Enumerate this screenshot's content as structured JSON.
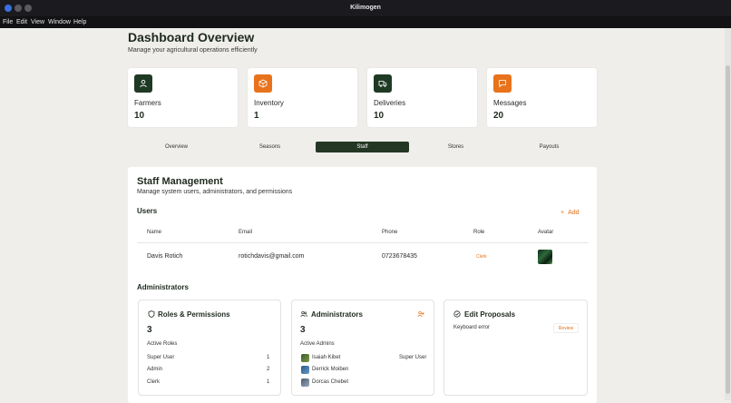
{
  "window": {
    "title": "Kilimogen"
  },
  "menu": [
    "File",
    "Edit",
    "View",
    "Window",
    "Help"
  ],
  "header": {
    "title": "Dashboard Overview",
    "subtitle": "Manage your agricultural operations efficiently"
  },
  "stats": [
    {
      "label": "Farmers",
      "value": "10",
      "icon": "user-icon",
      "color": "#1f3a24"
    },
    {
      "label": "Inventory",
      "value": "1",
      "icon": "box-icon",
      "color": "#e8731c"
    },
    {
      "label": "Deliveries",
      "value": "10",
      "icon": "truck-icon",
      "color": "#1f3a24"
    },
    {
      "label": "Messages",
      "value": "20",
      "icon": "message-icon",
      "color": "#e8731c"
    }
  ],
  "tabs": [
    {
      "label": "Overview"
    },
    {
      "label": "Seasons"
    },
    {
      "label": "Staff",
      "active": true
    },
    {
      "label": "Stores"
    },
    {
      "label": "Payouts"
    }
  ],
  "staff": {
    "title": "Staff Management",
    "subtitle": "Manage system users, administrators, and permissions",
    "users_heading": "Users",
    "add_label": "Add",
    "columns": [
      "Name",
      "Email",
      "Phone",
      "Role",
      "Avatar"
    ],
    "users": [
      {
        "name": "Davis Rotich",
        "email": "rotichdavis@gmail.com",
        "phone": "0723678435",
        "role": "Clerk"
      }
    ],
    "admins_heading": "Administrators"
  },
  "roles_card": {
    "title": "Roles & Permissions",
    "count": "3",
    "caption": "Active Roles",
    "roles": [
      {
        "name": "Super User",
        "count": "1"
      },
      {
        "name": "Admin",
        "count": "2"
      },
      {
        "name": "Clerk",
        "count": "1"
      }
    ]
  },
  "admins_card": {
    "title": "Administrators",
    "count": "3",
    "caption": "Active Admins",
    "admins": [
      {
        "name": "Isaiah Kibet",
        "role": "Super User"
      },
      {
        "name": "Derrick Moiben",
        "role": ""
      },
      {
        "name": "Dorcas Chebet",
        "role": ""
      }
    ]
  },
  "proposals_card": {
    "title": "Edit Proposals",
    "items": [
      {
        "text": "Keyboard error",
        "action": "Review"
      }
    ]
  },
  "colors": {
    "accent": "#e0721c",
    "primary": "#243624",
    "background": "#efeeea"
  }
}
